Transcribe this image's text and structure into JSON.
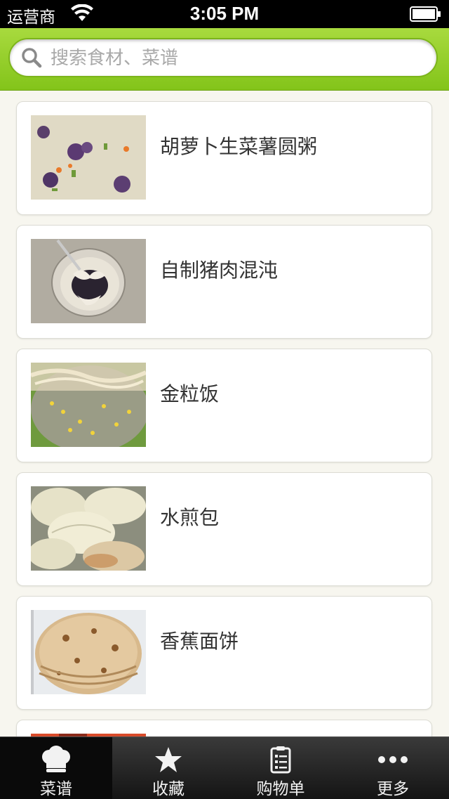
{
  "status_bar": {
    "carrier": "运营商",
    "time": "3:05 PM"
  },
  "search": {
    "placeholder": "搜索食材、菜谱",
    "value": ""
  },
  "recipes": [
    {
      "title": "胡萝卜生菜薯圆粥"
    },
    {
      "title": "自制猪肉混沌"
    },
    {
      "title": "金粒饭"
    },
    {
      "title": "水煎包"
    },
    {
      "title": "香蕉面饼"
    }
  ],
  "tab_bar": {
    "tabs": [
      {
        "label": "菜谱",
        "icon": "chef-hat-icon",
        "active": true
      },
      {
        "label": "收藏",
        "icon": "star-icon",
        "active": false
      },
      {
        "label": "购物单",
        "icon": "clipboard-list-icon",
        "active": false
      },
      {
        "label": "更多",
        "icon": "more-dots-icon",
        "active": false
      }
    ]
  },
  "colors": {
    "header_green": "#8dc923",
    "tab_bar": "#1f1f1f",
    "background": "#f7f6ef"
  }
}
